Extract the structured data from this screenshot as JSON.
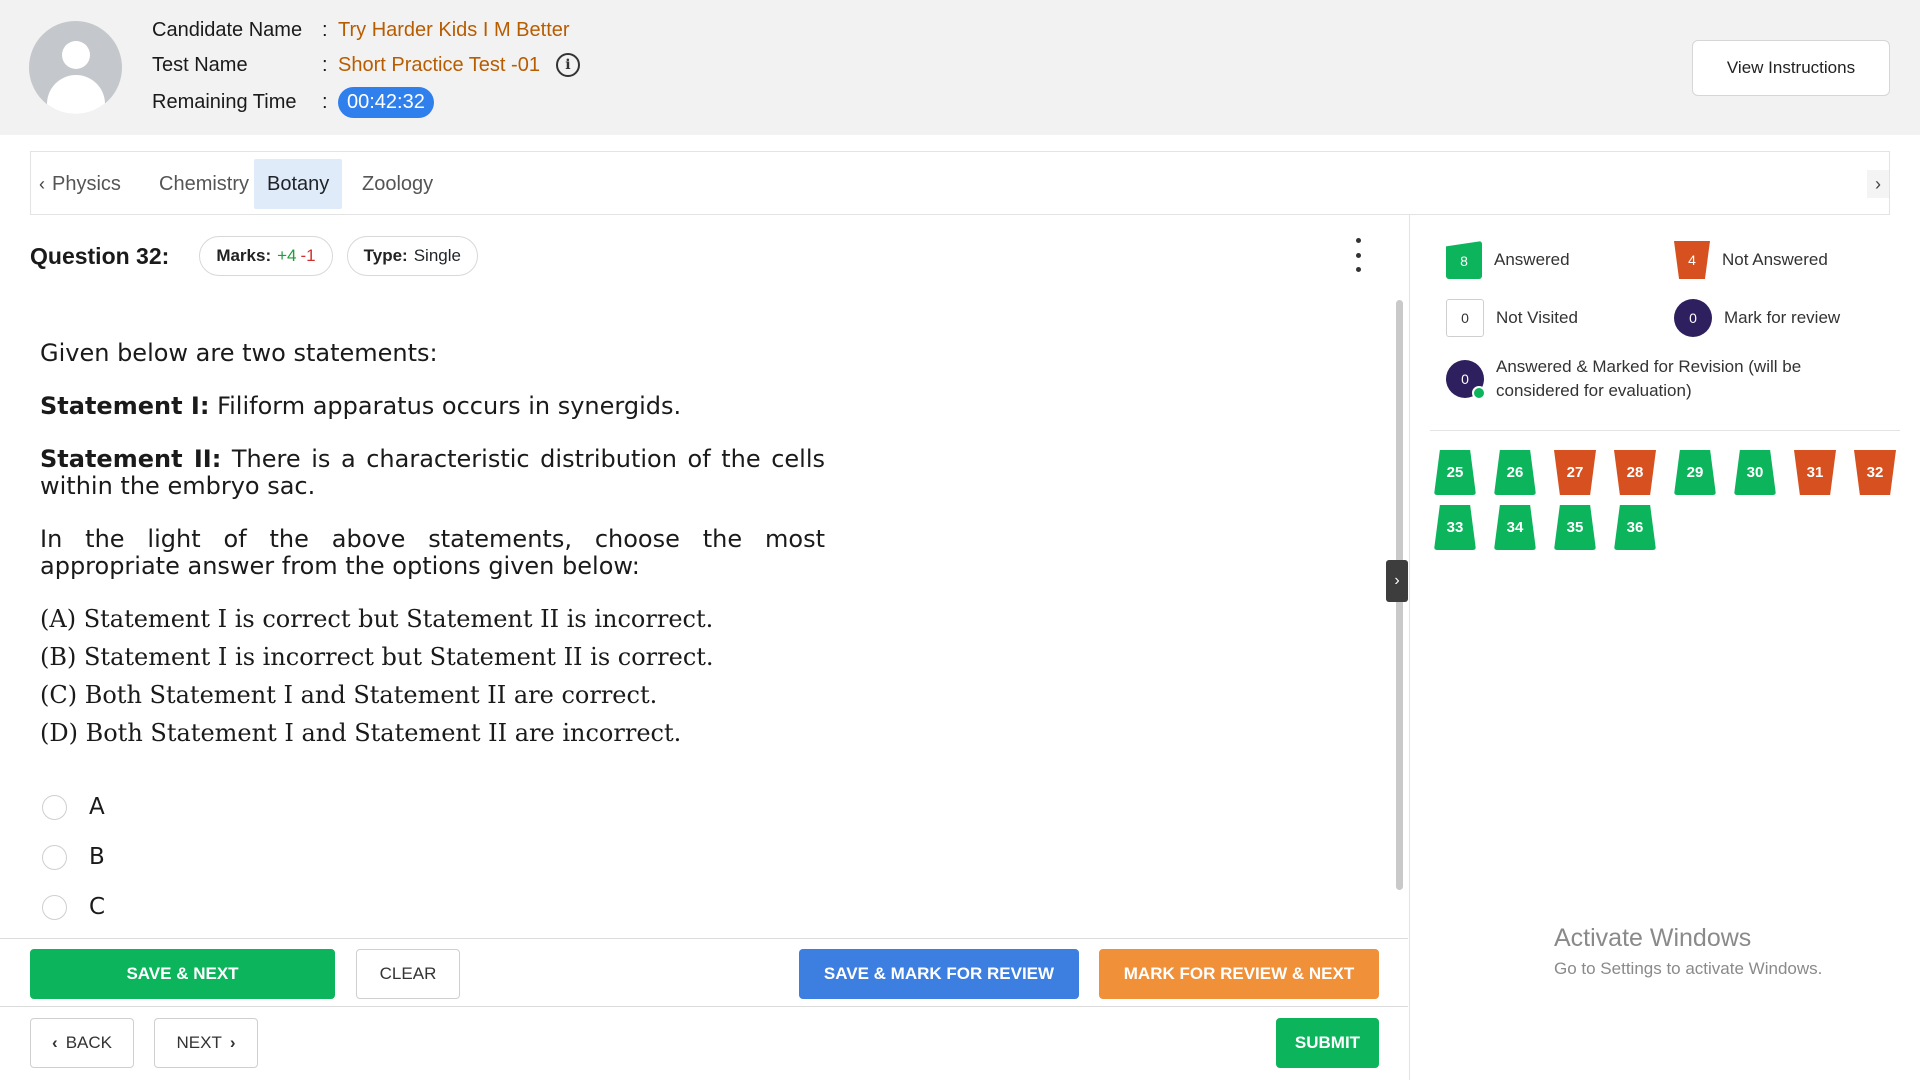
{
  "header": {
    "candidate_label": "Candidate Name",
    "candidate_value": "Try Harder Kids I M Better",
    "test_label": "Test Name",
    "test_value": "Short Practice Test -01",
    "time_label": "Remaining Time",
    "time_value": "00:42:32",
    "colon": ":",
    "view_instructions": "View Instructions"
  },
  "tabs": [
    "Physics",
    "Chemistry",
    "Botany",
    "Zoology"
  ],
  "active_tab": "Botany",
  "question": {
    "title": "Question 32:",
    "marks_label": "Marks:",
    "marks_pos": "+4",
    "marks_neg": "-1",
    "type_label": "Type:",
    "type_value": "Single",
    "intro": "Given below are two statements:",
    "s1_label": "Statement I:",
    "s1_text": " Filiform apparatus occurs in synergids.",
    "s2_label": "Statement II:",
    "s2_text": " There is a characteristic distribution of the cells within the embryo sac.",
    "prompt": "In the light of the above statements, choose the most appropriate answer from the options given below:",
    "opt_a": "(A) Statement I is correct but Statement II is incorrect.",
    "opt_b": "(B) Statement I is incorrect but Statement II is correct.",
    "opt_c": "(C) Both Statement I and Statement II are correct.",
    "opt_d": "(D) Both Statement I and Statement II are incorrect.",
    "choices": [
      "A",
      "B",
      "C"
    ]
  },
  "actions": {
    "save_next": "SAVE & NEXT",
    "clear": "CLEAR",
    "save_mark_review": "SAVE & MARK FOR REVIEW",
    "mark_review_next": "MARK FOR REVIEW & NEXT",
    "back": "BACK",
    "next": "NEXT",
    "submit": "SUBMIT"
  },
  "legend": {
    "answered_count": "8",
    "answered_label": "Answered",
    "not_answered_count": "4",
    "not_answered_label": "Not Answered",
    "not_visited_count": "0",
    "not_visited_label": "Not Visited",
    "mark_review_count": "0",
    "mark_review_label": "Mark for review",
    "ans_marked_count": "0",
    "ans_marked_label": "Answered & Marked for Revision (will be considered for evaluation)"
  },
  "palette": [
    {
      "num": "25",
      "status": "answered"
    },
    {
      "num": "26",
      "status": "answered"
    },
    {
      "num": "27",
      "status": "not_answered"
    },
    {
      "num": "28",
      "status": "not_answered"
    },
    {
      "num": "29",
      "status": "answered"
    },
    {
      "num": "30",
      "status": "answered"
    },
    {
      "num": "31",
      "status": "not_answered"
    },
    {
      "num": "32",
      "status": "not_answered"
    },
    {
      "num": "33",
      "status": "answered"
    },
    {
      "num": "34",
      "status": "answered"
    },
    {
      "num": "35",
      "status": "answered"
    },
    {
      "num": "36",
      "status": "answered"
    }
  ],
  "watermark": {
    "line1": "Activate Windows",
    "line2": "Go to Settings to activate Windows."
  },
  "colors": {
    "answered": "#0cb55b",
    "not_answered": "#d6511f",
    "mark_review": "#2e1f5e",
    "accent_blue": "#3d7fe0",
    "accent_orange": "#f0913a"
  }
}
